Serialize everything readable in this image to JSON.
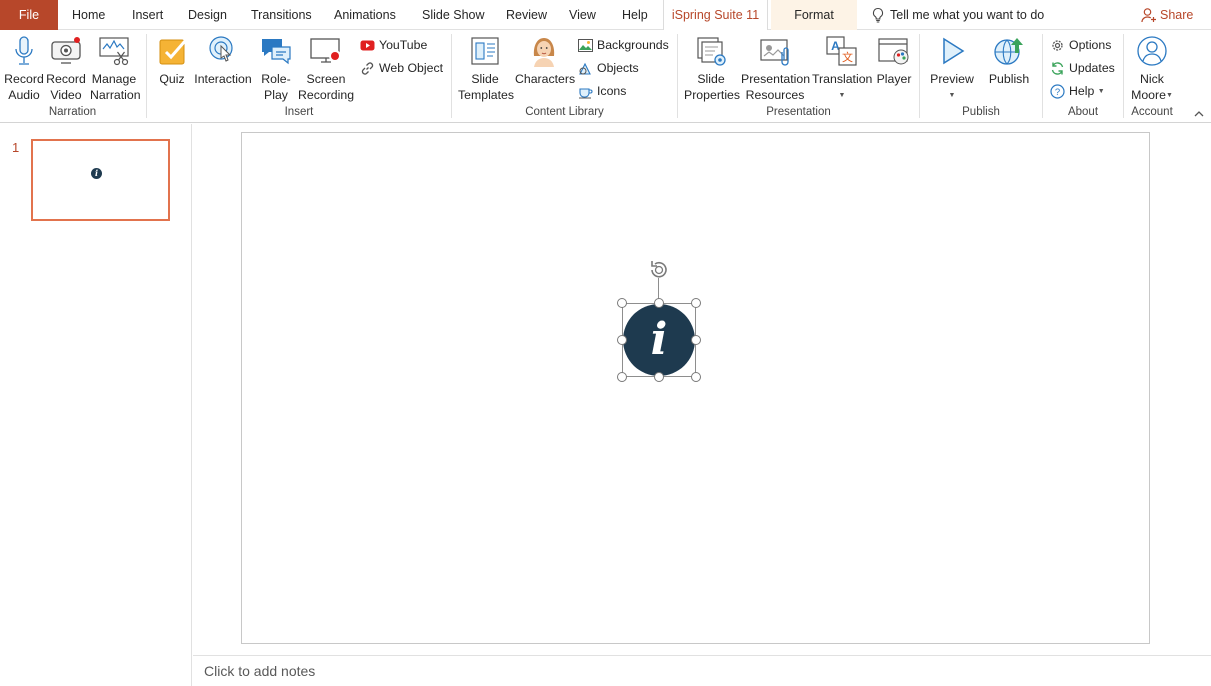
{
  "tabs": {
    "file": "File",
    "home": "Home",
    "insert": "Insert",
    "design": "Design",
    "transitions": "Transitions",
    "animations": "Animations",
    "slideshow": "Slide Show",
    "review": "Review",
    "view": "View",
    "help": "Help",
    "ispring": "iSpring Suite 11",
    "format": "Format"
  },
  "tell_me": "Tell me what you want to do",
  "share": "Share",
  "ribbon": {
    "narration": {
      "label": "Narration",
      "record_audio": [
        "Record",
        "Audio"
      ],
      "record_video": [
        "Record",
        "Video"
      ],
      "manage_narration": [
        "Manage",
        "Narration"
      ]
    },
    "insert": {
      "label": "Insert",
      "quiz": "Quiz",
      "interaction": "Interaction",
      "roleplay": [
        "Role-",
        "Play"
      ],
      "screen_recording": [
        "Screen",
        "Recording"
      ],
      "youtube": "YouTube",
      "web_object": "Web Object"
    },
    "content_library": {
      "label": "Content Library",
      "slide_templates": [
        "Slide",
        "Templates"
      ],
      "characters": "Characters",
      "backgrounds": "Backgrounds",
      "objects": "Objects",
      "icons": "Icons"
    },
    "presentation": {
      "label": "Presentation",
      "slide_properties": [
        "Slide",
        "Properties"
      ],
      "presentation_resources": [
        "Presentation",
        "Resources"
      ],
      "translation": "Translation",
      "player": "Player"
    },
    "publish": {
      "label": "Publish",
      "preview": "Preview",
      "publish": "Publish"
    },
    "about": {
      "label": "About",
      "options": "Options",
      "updates": "Updates",
      "help": "Help"
    },
    "account": {
      "label": "Account",
      "name": [
        "Nick",
        "Moore"
      ]
    }
  },
  "thumbnails": [
    {
      "number": "1"
    }
  ],
  "slide": {
    "icon_glyph": "i"
  },
  "notes_placeholder": "Click to add notes",
  "colors": {
    "accent": "#b7472a",
    "info_icon": "#1e3a4f",
    "thumb_border": "#e2734d",
    "format_tab_bg": "#fdf3e6"
  }
}
